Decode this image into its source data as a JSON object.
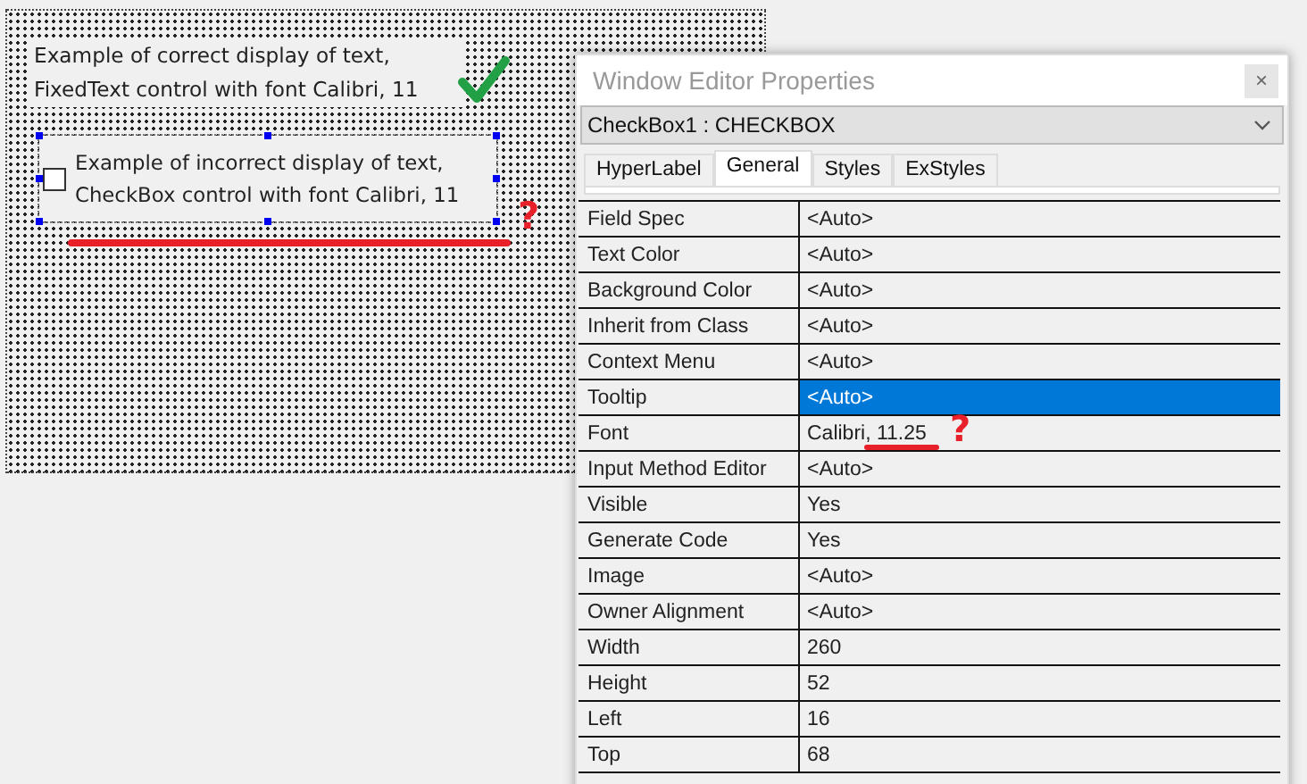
{
  "canvas": {
    "fixed_text": {
      "lines": [
        "Example of correct display of text,",
        "FixedText control with font Calibri, 11"
      ]
    },
    "checkbox_control": {
      "checked": false,
      "selected": true,
      "lines": [
        "Example of incorrect display of text,",
        "CheckBox control with font Calibri, 11"
      ]
    },
    "annotation": "?"
  },
  "properties_window": {
    "title": "Window Editor Properties",
    "close": "×",
    "object_selector": "CheckBox1  :  CHECKBOX",
    "tabs": [
      {
        "label": "HyperLabel",
        "selected": false
      },
      {
        "label": "General",
        "selected": true
      },
      {
        "label": "Styles",
        "selected": false
      },
      {
        "label": "ExStyles",
        "selected": false
      }
    ],
    "rows": [
      {
        "name": "Field Spec",
        "value": "<Auto>",
        "selected": false
      },
      {
        "name": "Text Color",
        "value": "<Auto>",
        "selected": false
      },
      {
        "name": "Background Color",
        "value": "<Auto>",
        "selected": false
      },
      {
        "name": "Inherit from Class",
        "value": "<Auto>",
        "selected": false
      },
      {
        "name": "Context Menu",
        "value": "<Auto>",
        "selected": false
      },
      {
        "name": "Tooltip",
        "value": "<Auto>",
        "selected": true
      },
      {
        "name": "Font",
        "value": "Calibri, 11.25",
        "selected": false,
        "annotation": "?"
      },
      {
        "name": "Input Method Editor",
        "value": "<Auto>",
        "selected": false
      },
      {
        "name": "Visible",
        "value": "Yes",
        "selected": false
      },
      {
        "name": "Generate Code",
        "value": "Yes",
        "selected": false
      },
      {
        "name": "Image",
        "value": "<Auto>",
        "selected": false
      },
      {
        "name": "Owner Alignment",
        "value": "<Auto>",
        "selected": false
      },
      {
        "name": "Width",
        "value": "260",
        "selected": false
      },
      {
        "name": "Height",
        "value": "52",
        "selected": false
      },
      {
        "name": "Left",
        "value": "16",
        "selected": false
      },
      {
        "name": "Top",
        "value": "68",
        "selected": false
      }
    ]
  }
}
